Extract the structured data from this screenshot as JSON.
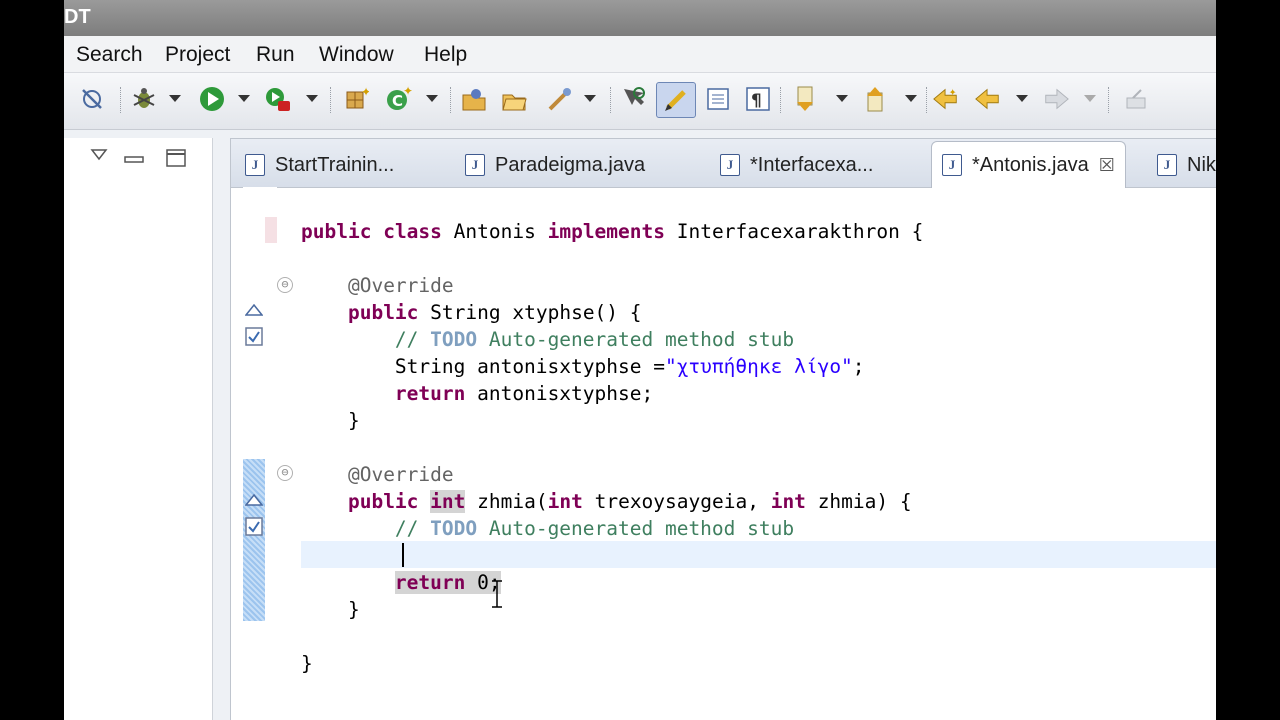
{
  "window": {
    "title_fragment": "DT"
  },
  "menu": [
    "Search",
    "Project",
    "Run",
    "Window",
    "Help"
  ],
  "toolbar": {
    "icons": [
      "skip-breakpoints-icon",
      "debug-icon",
      "run-icon",
      "run-external-icon",
      "new-package-icon",
      "new-class-icon",
      "open-type-icon",
      "open-task-icon",
      "search-icon",
      "next-annotation-icon",
      "mark-occurrences-icon",
      "block-selection-icon",
      "show-whitespace-icon",
      "next-annotation-down-icon",
      "prev-annotation-up-icon",
      "last-edit-icon",
      "back-icon",
      "forward-icon",
      "pin-editor-icon"
    ]
  },
  "tabs": [
    {
      "label": "StartTrainin...",
      "active": false
    },
    {
      "label": "Paradeigma.java",
      "active": false
    },
    {
      "label": "*Interfacexa...",
      "active": false
    },
    {
      "label": "*Antonis.java",
      "active": true
    },
    {
      "label": "Nik",
      "active": false
    }
  ],
  "tab_icon_letter": "J",
  "code": {
    "kw_public": "public",
    "kw_class": "class",
    "kw_implements": "implements",
    "kw_int": "int",
    "kw_return": "return",
    "class_name": "Antonis",
    "interface_name": "Interfacexarakthron",
    "override": "@Override",
    "method1_return_type": "String",
    "method1_sig": "xtyphse() {",
    "todo_prefix": "// ",
    "todo_word": "TODO",
    "todo_text": " Auto-generated method stub",
    "var_decl": "String antonisxtyphse =",
    "string_literal": "\"χτυπήθηκε λίγο\"",
    "semicolon": ";",
    "return1_value": "antonisxtyphse;",
    "close_brace": "}",
    "method2_name": "zhmia(",
    "param1": "trexoysaygeia, ",
    "param2": "zhmia) {",
    "return2_value": "0",
    "open_brace_class": "{"
  }
}
